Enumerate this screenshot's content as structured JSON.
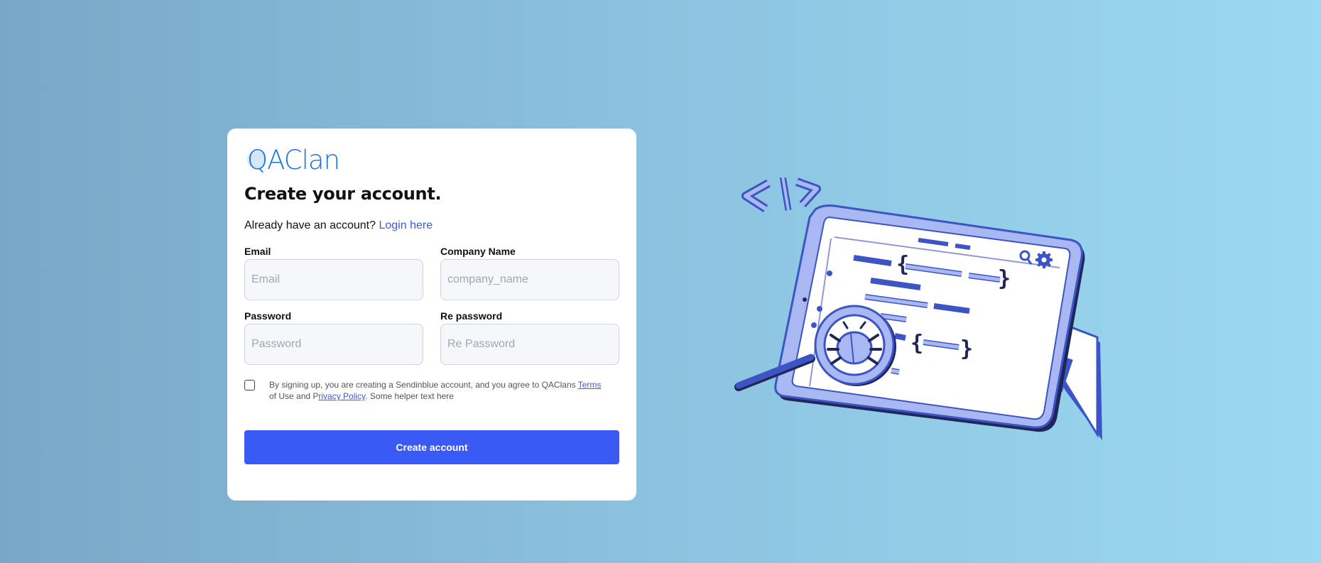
{
  "logo": {
    "text": "QAClan",
    "color": "#1674e6"
  },
  "heading": "Create your account.",
  "login": {
    "prompt": "Already have an account?",
    "link": "Login here"
  },
  "fields": {
    "email": {
      "label": "Email",
      "placeholder": "Email",
      "value": ""
    },
    "company": {
      "label": "Company Name",
      "placeholder": "company_name",
      "value": ""
    },
    "password": {
      "label": "Password",
      "placeholder": "Password",
      "value": ""
    },
    "repassword": {
      "label": "Re password",
      "placeholder": "Re Password",
      "value": ""
    }
  },
  "terms": {
    "checked": false,
    "part1": "By signing up, you are creating a Sendinblue account, and you agree to QAClans ",
    "terms_link": "Terms",
    "part2": " of Use and P",
    "privacy_link": "rivacy Policy",
    "part3": ". Some helper text here"
  },
  "submit_label": "Create account",
  "colors": {
    "primary": "#3a5af5",
    "link": "#3b5bdb",
    "illustration_dark": "#3d55c4",
    "illustration_light": "#a9b8f2"
  },
  "illustration": {
    "icons": [
      "code-brackets-icon",
      "search-icon",
      "gear-icon",
      "bug-icon",
      "magnifier-icon",
      "warning-icon"
    ]
  }
}
